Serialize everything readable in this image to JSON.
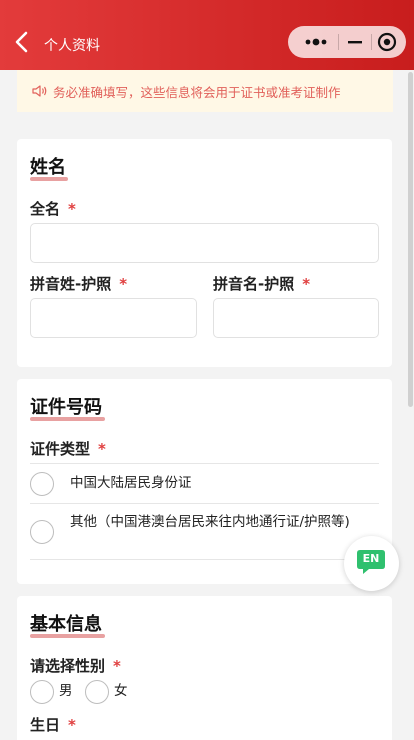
{
  "header": {
    "title": "个人资料"
  },
  "notice": {
    "text": "务必准确填写，这些信息将会用于证书或准考证制作"
  },
  "sections": {
    "name": {
      "title": "姓名",
      "full_name_label": "全名",
      "surname_label": "拼音姓-护照",
      "given_name_label": "拼音名-护照",
      "required_mark": "*",
      "full_name_value": "",
      "surname_value": "",
      "given_name_value": ""
    },
    "id": {
      "title": "证件号码",
      "type_label": "证件类型",
      "required_mark": "*",
      "options": [
        "中国大陆居民身份证",
        "其他（中国港澳台居民来往内地通行证/护照等)"
      ]
    },
    "basic": {
      "title": "基本信息",
      "gender_label": "请选择性别",
      "required_mark": "*",
      "gender_options": [
        "男",
        "女"
      ],
      "birthday_label": "生日"
    }
  },
  "floating": {
    "lang_label": "EN"
  },
  "colors": {
    "header_start": "#e33b3b",
    "header_end": "#c81d1d",
    "accent_underline": "#e8a1a1",
    "required": "#e04040",
    "notice_text": "#e1605a",
    "lang_green": "#2fc06e"
  }
}
